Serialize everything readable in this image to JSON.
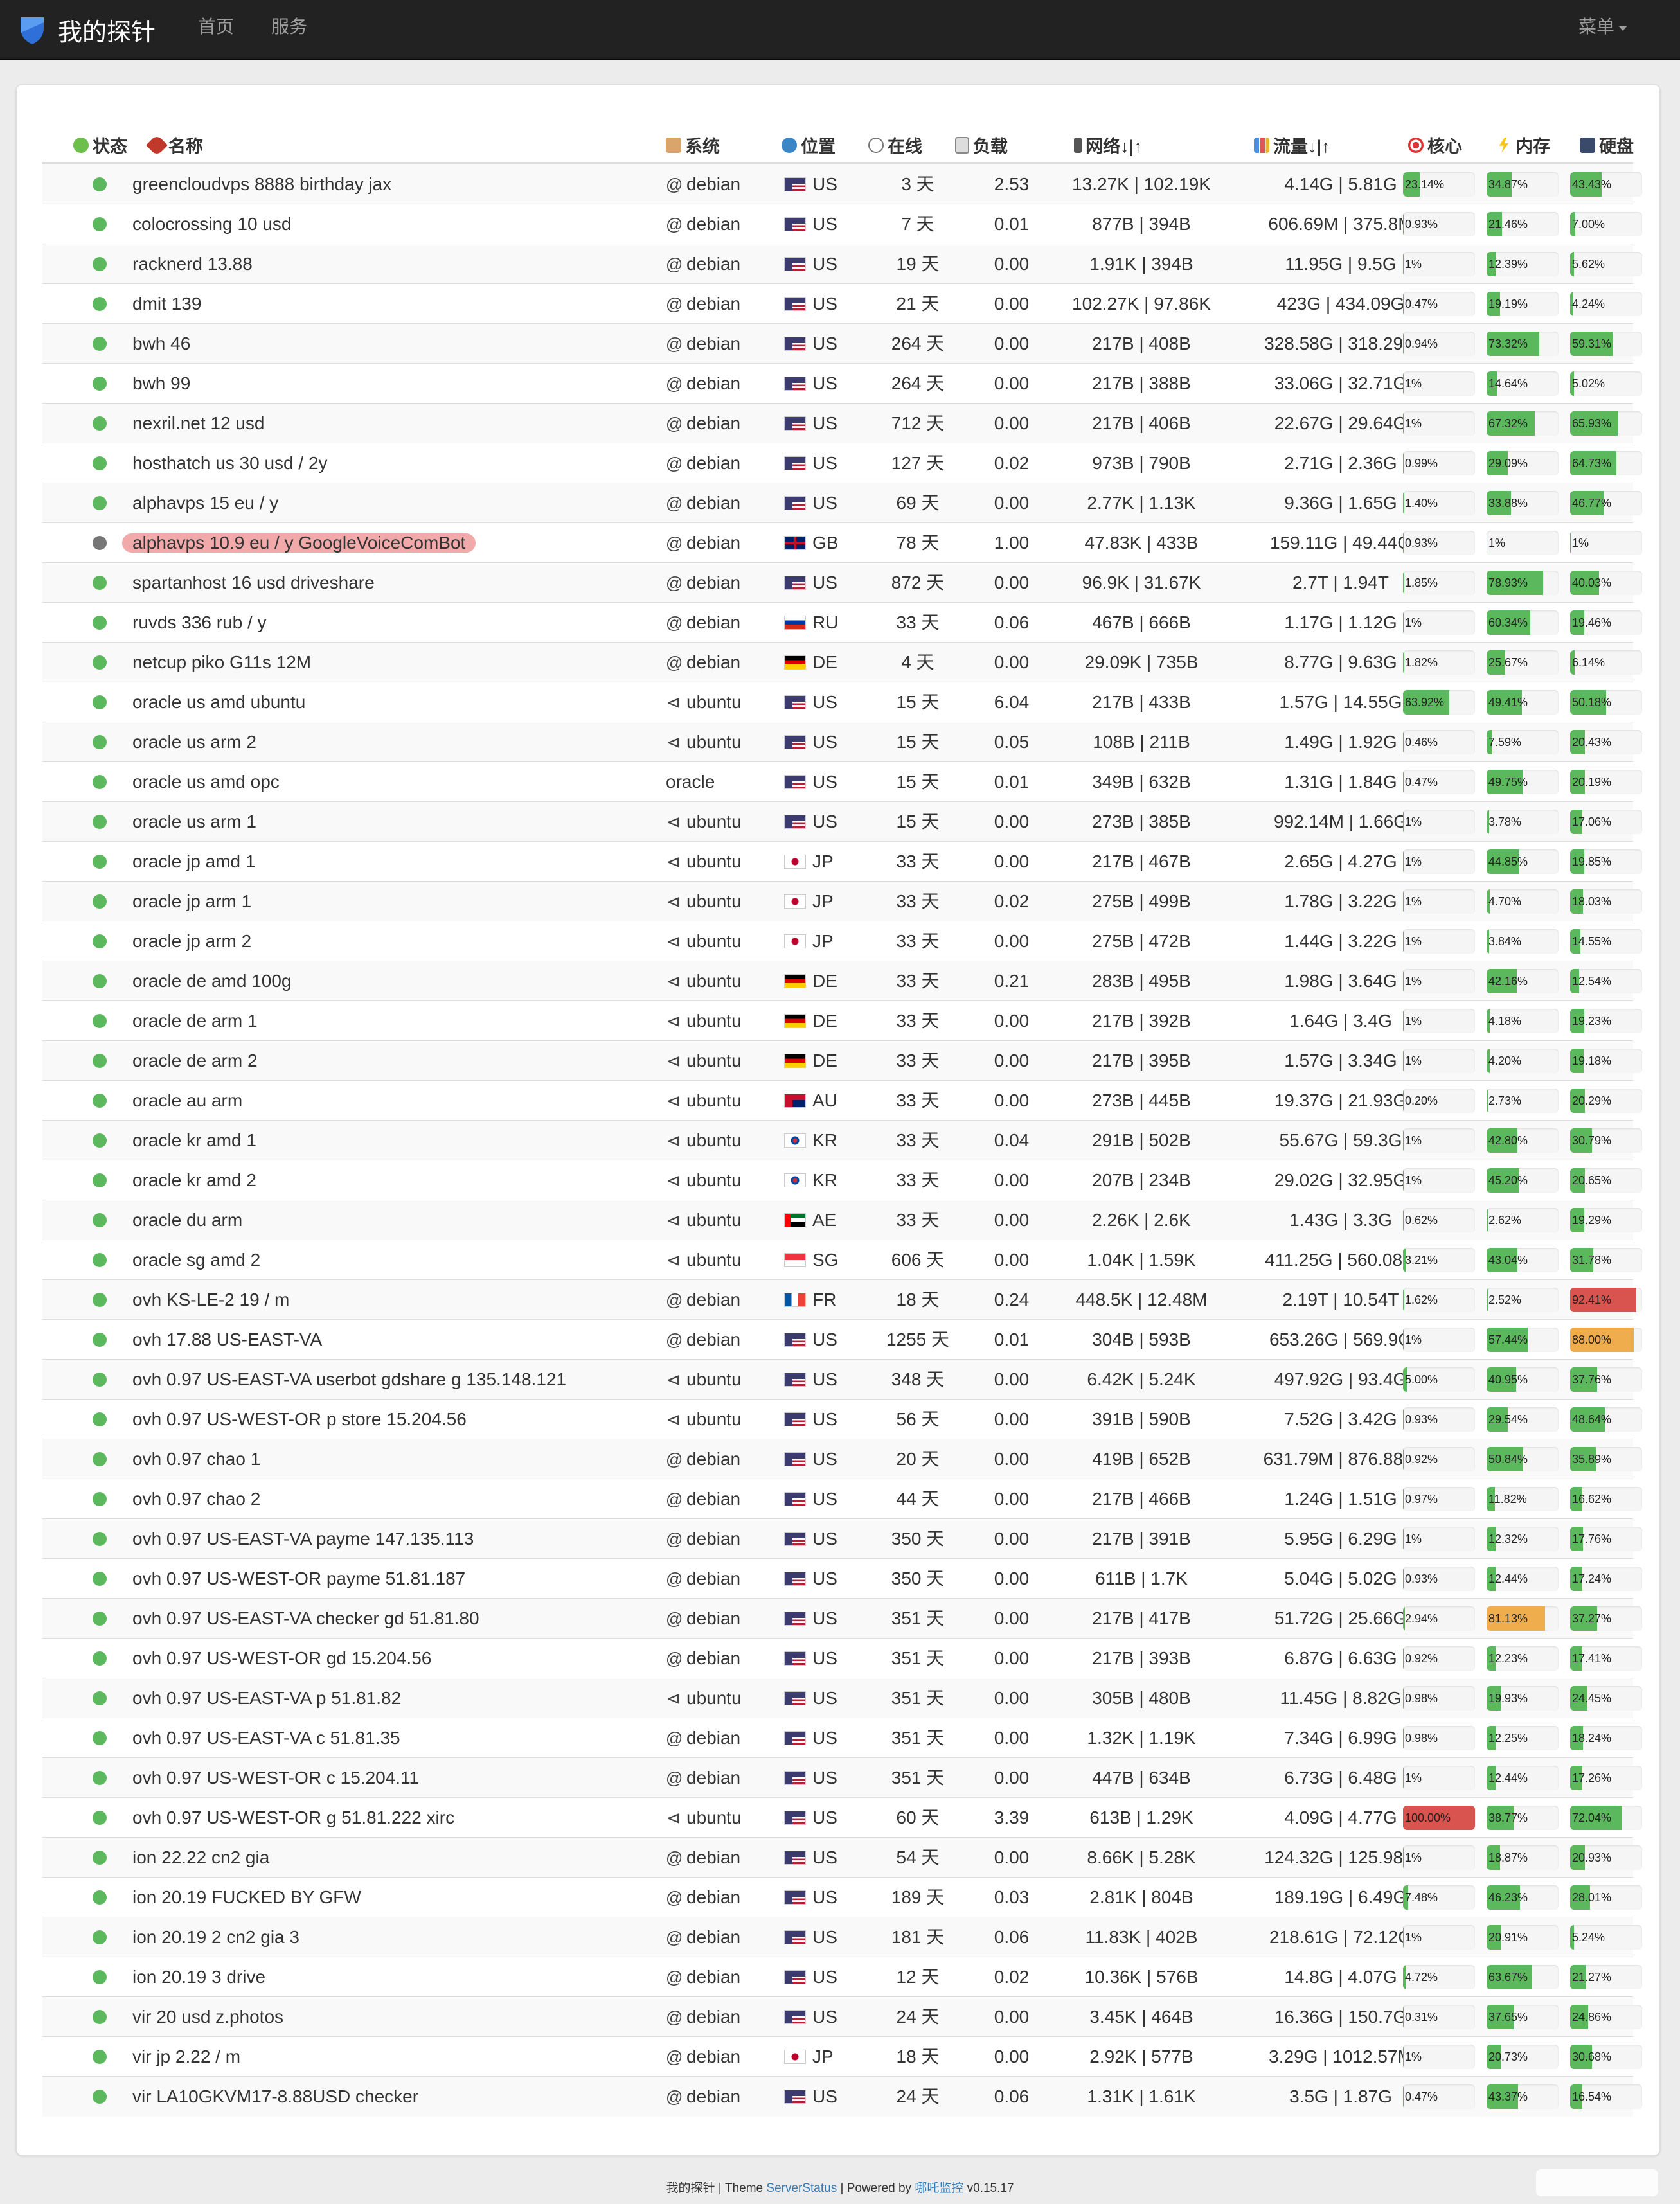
{
  "navbar": {
    "brand": "我的探针",
    "links": [
      "首页",
      "服务"
    ],
    "menu": "菜单"
  },
  "headers": {
    "status": "状态",
    "name": "名称",
    "os": "系统",
    "location": "位置",
    "uptime": "在线",
    "load": "负载",
    "network": "网络↓|↑",
    "traffic": "流量↓|↑",
    "cpu": "核心",
    "memory": "内存",
    "disk": "硬盘"
  },
  "header_icons": {
    "status": "clover-icon",
    "name": "rocket-icon",
    "os": "cabinet-icon",
    "location": "globe-icon",
    "uptime": "clock-icon",
    "load": "clipboard-icon",
    "network": "traffic-light-icon",
    "traffic": "bar-chart-icon",
    "cpu": "target-icon",
    "memory": "lightning-icon",
    "disk": "floppy-disk-icon"
  },
  "colors": {
    "online": "#5cb85c",
    "offline": "#777777",
    "bar_ok": "#5cb85c",
    "bar_warn": "#f0ad4e",
    "bar_danger": "#d9534f",
    "highlight": "#f2a9a9"
  },
  "servers": [
    {
      "online": true,
      "name": "greencloudvps 8888 birthday jax",
      "os": "debian",
      "loc": "US",
      "uptime": "3 天",
      "load": "2.53",
      "net": "13.27K | 102.19K",
      "traffic": "4.14G | 5.81G",
      "cpu": "23.14%",
      "mem": "34.87%",
      "disk": "43.43%"
    },
    {
      "online": true,
      "name": "colocrossing 10 usd",
      "os": "debian",
      "loc": "US",
      "uptime": "7 天",
      "load": "0.01",
      "net": "877B | 394B",
      "traffic": "606.69M | 375.8M",
      "cpu": "0.93%",
      "mem": "21.46%",
      "disk": "7.00%"
    },
    {
      "online": true,
      "name": "racknerd 13.88",
      "os": "debian",
      "loc": "US",
      "uptime": "19 天",
      "load": "0.00",
      "net": "1.91K | 394B",
      "traffic": "11.95G | 9.5G",
      "cpu": "1%",
      "mem": "12.39%",
      "disk": "5.62%"
    },
    {
      "online": true,
      "name": "dmit 139",
      "os": "debian",
      "loc": "US",
      "uptime": "21 天",
      "load": "0.00",
      "net": "102.27K | 97.86K",
      "traffic": "423G | 434.09G",
      "cpu": "0.47%",
      "mem": "19.19%",
      "disk": "4.24%"
    },
    {
      "online": true,
      "name": "bwh 46",
      "os": "debian",
      "loc": "US",
      "uptime": "264 天",
      "load": "0.00",
      "net": "217B | 408B",
      "traffic": "328.58G | 318.29G",
      "cpu": "0.94%",
      "mem": "73.32%",
      "disk": "59.31%"
    },
    {
      "online": true,
      "name": "bwh 99",
      "os": "debian",
      "loc": "US",
      "uptime": "264 天",
      "load": "0.00",
      "net": "217B | 388B",
      "traffic": "33.06G | 32.71G",
      "cpu": "1%",
      "mem": "14.64%",
      "disk": "5.02%"
    },
    {
      "online": true,
      "name": "nexril.net 12 usd",
      "os": "debian",
      "loc": "US",
      "uptime": "712 天",
      "load": "0.00",
      "net": "217B | 406B",
      "traffic": "22.67G | 29.64G",
      "cpu": "1%",
      "mem": "67.32%",
      "disk": "65.93%"
    },
    {
      "online": true,
      "name": "hosthatch us 30 usd / 2y",
      "os": "debian",
      "loc": "US",
      "uptime": "127 天",
      "load": "0.02",
      "net": "973B | 790B",
      "traffic": "2.71G | 2.36G",
      "cpu": "0.99%",
      "mem": "29.09%",
      "disk": "64.73%"
    },
    {
      "online": true,
      "name": "alphavps 15 eu / y",
      "os": "debian",
      "loc": "US",
      "uptime": "69 天",
      "load": "0.00",
      "net": "2.77K | 1.13K",
      "traffic": "9.36G | 1.65G",
      "cpu": "1.40%",
      "mem": "33.88%",
      "disk": "46.77%"
    },
    {
      "online": false,
      "name": "alphavps 10.9 eu / y GoogleVoiceComBot",
      "highlight": true,
      "os": "debian",
      "loc": "GB",
      "uptime": "78 天",
      "load": "1.00",
      "net": "47.83K | 433B",
      "traffic": "159.11G | 49.44G",
      "cpu": "0.93%",
      "mem": "1%",
      "disk": "1%"
    },
    {
      "online": true,
      "name": "spartanhost 16 usd driveshare",
      "os": "debian",
      "loc": "US",
      "uptime": "872 天",
      "load": "0.00",
      "net": "96.9K | 31.67K",
      "traffic": "2.7T | 1.94T",
      "cpu": "1.85%",
      "mem": "78.93%",
      "disk": "40.03%"
    },
    {
      "online": true,
      "name": "ruvds 336 rub / y",
      "os": "debian",
      "loc": "RU",
      "uptime": "33 天",
      "load": "0.06",
      "net": "467B | 666B",
      "traffic": "1.17G | 1.12G",
      "cpu": "1%",
      "mem": "60.34%",
      "disk": "19.46%"
    },
    {
      "online": true,
      "name": "netcup piko G11s 12M",
      "os": "debian",
      "loc": "DE",
      "uptime": "4 天",
      "load": "0.00",
      "net": "29.09K | 735B",
      "traffic": "8.77G | 9.63G",
      "cpu": "1.82%",
      "mem": "25.67%",
      "disk": "6.14%"
    },
    {
      "online": true,
      "name": "oracle us amd ubuntu",
      "os": "ubuntu",
      "loc": "US",
      "uptime": "15 天",
      "load": "6.04",
      "net": "217B | 433B",
      "traffic": "1.57G | 14.55G",
      "cpu": "63.92%",
      "mem": "49.41%",
      "disk": "50.18%"
    },
    {
      "online": true,
      "name": "oracle us arm 2",
      "os": "ubuntu",
      "loc": "US",
      "uptime": "15 天",
      "load": "0.05",
      "net": "108B | 211B",
      "traffic": "1.49G | 1.92G",
      "cpu": "0.46%",
      "mem": "7.59%",
      "disk": "20.43%"
    },
    {
      "online": true,
      "name": "oracle us amd opc",
      "os": "oracle",
      "loc": "US",
      "uptime": "15 天",
      "load": "0.01",
      "net": "349B | 632B",
      "traffic": "1.31G | 1.84G",
      "cpu": "0.47%",
      "mem": "49.75%",
      "disk": "20.19%"
    },
    {
      "online": true,
      "name": "oracle us arm 1",
      "os": "ubuntu",
      "loc": "US",
      "uptime": "15 天",
      "load": "0.00",
      "net": "273B | 385B",
      "traffic": "992.14M | 1.66G",
      "cpu": "1%",
      "mem": "3.78%",
      "disk": "17.06%"
    },
    {
      "online": true,
      "name": "oracle jp amd 1",
      "os": "ubuntu",
      "loc": "JP",
      "uptime": "33 天",
      "load": "0.00",
      "net": "217B | 467B",
      "traffic": "2.65G | 4.27G",
      "cpu": "1%",
      "mem": "44.85%",
      "disk": "19.85%"
    },
    {
      "online": true,
      "name": "oracle jp arm 1",
      "os": "ubuntu",
      "loc": "JP",
      "uptime": "33 天",
      "load": "0.02",
      "net": "275B | 499B",
      "traffic": "1.78G | 3.22G",
      "cpu": "1%",
      "mem": "4.70%",
      "disk": "18.03%"
    },
    {
      "online": true,
      "name": "oracle jp arm 2",
      "os": "ubuntu",
      "loc": "JP",
      "uptime": "33 天",
      "load": "0.00",
      "net": "275B | 472B",
      "traffic": "1.44G | 3.22G",
      "cpu": "1%",
      "mem": "3.84%",
      "disk": "14.55%"
    },
    {
      "online": true,
      "name": "oracle de amd 100g",
      "os": "ubuntu",
      "loc": "DE",
      "uptime": "33 天",
      "load": "0.21",
      "net": "283B | 495B",
      "traffic": "1.98G | 3.64G",
      "cpu": "1%",
      "mem": "42.16%",
      "disk": "12.54%"
    },
    {
      "online": true,
      "name": "oracle de arm 1",
      "os": "ubuntu",
      "loc": "DE",
      "uptime": "33 天",
      "load": "0.00",
      "net": "217B | 392B",
      "traffic": "1.64G | 3.4G",
      "cpu": "1%",
      "mem": "4.18%",
      "disk": "19.23%"
    },
    {
      "online": true,
      "name": "oracle de arm 2",
      "os": "ubuntu",
      "loc": "DE",
      "uptime": "33 天",
      "load": "0.00",
      "net": "217B | 395B",
      "traffic": "1.57G | 3.34G",
      "cpu": "1%",
      "mem": "4.20%",
      "disk": "19.18%"
    },
    {
      "online": true,
      "name": "oracle au arm",
      "os": "ubuntu",
      "loc": "AU",
      "uptime": "33 天",
      "load": "0.00",
      "net": "273B | 445B",
      "traffic": "19.37G | 21.93G",
      "cpu": "0.20%",
      "mem": "2.73%",
      "disk": "20.29%"
    },
    {
      "online": true,
      "name": "oracle kr amd 1",
      "os": "ubuntu",
      "loc": "KR",
      "uptime": "33 天",
      "load": "0.04",
      "net": "291B | 502B",
      "traffic": "55.67G | 59.3G",
      "cpu": "1%",
      "mem": "42.80%",
      "disk": "30.79%"
    },
    {
      "online": true,
      "name": "oracle kr amd 2",
      "os": "ubuntu",
      "loc": "KR",
      "uptime": "33 天",
      "load": "0.00",
      "net": "207B | 234B",
      "traffic": "29.02G | 32.95G",
      "cpu": "1%",
      "mem": "45.20%",
      "disk": "20.65%"
    },
    {
      "online": true,
      "name": "oracle du arm",
      "os": "ubuntu",
      "loc": "AE",
      "uptime": "33 天",
      "load": "0.00",
      "net": "2.26K | 2.6K",
      "traffic": "1.43G | 3.3G",
      "cpu": "0.62%",
      "mem": "2.62%",
      "disk": "19.29%"
    },
    {
      "online": true,
      "name": "oracle sg amd 2",
      "os": "ubuntu",
      "loc": "SG",
      "uptime": "606 天",
      "load": "0.00",
      "net": "1.04K | 1.59K",
      "traffic": "411.25G | 560.08G",
      "cpu": "3.21%",
      "mem": "43.04%",
      "disk": "31.78%"
    },
    {
      "online": true,
      "name": "ovh KS-LE-2 19 / m",
      "os": "debian",
      "loc": "FR",
      "uptime": "18 天",
      "load": "0.24",
      "net": "448.5K | 12.48M",
      "traffic": "2.19T | 10.54T",
      "cpu": "1.62%",
      "mem": "2.52%",
      "disk": "92.41%"
    },
    {
      "online": true,
      "name": "ovh 17.88 US-EAST-VA",
      "os": "debian",
      "loc": "US",
      "uptime": "1255 天",
      "load": "0.01",
      "net": "304B | 593B",
      "traffic": "653.26G | 569.9G",
      "cpu": "1%",
      "mem": "57.44%",
      "disk": "88.00%"
    },
    {
      "online": true,
      "name": "ovh 0.97 US-EAST-VA userbot gdshare g 135.148.121",
      "os": "ubuntu",
      "loc": "US",
      "uptime": "348 天",
      "load": "0.00",
      "net": "6.42K | 5.24K",
      "traffic": "497.92G | 93.4G",
      "cpu": "5.00%",
      "mem": "40.95%",
      "disk": "37.76%"
    },
    {
      "online": true,
      "name": "ovh 0.97 US-WEST-OR p store 15.204.56",
      "os": "ubuntu",
      "loc": "US",
      "uptime": "56 天",
      "load": "0.00",
      "net": "391B | 590B",
      "traffic": "7.52G | 3.42G",
      "cpu": "0.93%",
      "mem": "29.54%",
      "disk": "48.64%"
    },
    {
      "online": true,
      "name": "ovh 0.97 chao 1",
      "os": "debian",
      "loc": "US",
      "uptime": "20 天",
      "load": "0.00",
      "net": "419B | 652B",
      "traffic": "631.79M | 876.88M",
      "cpu": "0.92%",
      "mem": "50.84%",
      "disk": "35.89%"
    },
    {
      "online": true,
      "name": "ovh 0.97 chao 2",
      "os": "debian",
      "loc": "US",
      "uptime": "44 天",
      "load": "0.00",
      "net": "217B | 466B",
      "traffic": "1.24G | 1.51G",
      "cpu": "0.97%",
      "mem": "11.82%",
      "disk": "16.62%"
    },
    {
      "online": true,
      "name": "ovh 0.97 US-EAST-VA payme 147.135.113",
      "os": "debian",
      "loc": "US",
      "uptime": "350 天",
      "load": "0.00",
      "net": "217B | 391B",
      "traffic": "5.95G | 6.29G",
      "cpu": "1%",
      "mem": "12.32%",
      "disk": "17.76%"
    },
    {
      "online": true,
      "name": "ovh 0.97 US-WEST-OR payme 51.81.187",
      "os": "debian",
      "loc": "US",
      "uptime": "350 天",
      "load": "0.00",
      "net": "611B | 1.7K",
      "traffic": "5.04G | 5.02G",
      "cpu": "0.93%",
      "mem": "12.44%",
      "disk": "17.24%"
    },
    {
      "online": true,
      "name": "ovh 0.97 US-EAST-VA checker gd 51.81.80",
      "os": "debian",
      "loc": "US",
      "uptime": "351 天",
      "load": "0.00",
      "net": "217B | 417B",
      "traffic": "51.72G | 25.66G",
      "cpu": "2.94%",
      "mem": "81.13%",
      "disk": "37.27%"
    },
    {
      "online": true,
      "name": "ovh 0.97 US-WEST-OR gd 15.204.56",
      "os": "debian",
      "loc": "US",
      "uptime": "351 天",
      "load": "0.00",
      "net": "217B | 393B",
      "traffic": "6.87G | 6.63G",
      "cpu": "0.92%",
      "mem": "12.23%",
      "disk": "17.41%"
    },
    {
      "online": true,
      "name": "ovh 0.97 US-EAST-VA p 51.81.82",
      "os": "ubuntu",
      "loc": "US",
      "uptime": "351 天",
      "load": "0.00",
      "net": "305B | 480B",
      "traffic": "11.45G | 8.82G",
      "cpu": "0.98%",
      "mem": "19.93%",
      "disk": "24.45%"
    },
    {
      "online": true,
      "name": "ovh 0.97 US-EAST-VA c 51.81.35",
      "os": "debian",
      "loc": "US",
      "uptime": "351 天",
      "load": "0.00",
      "net": "1.32K | 1.19K",
      "traffic": "7.34G | 6.99G",
      "cpu": "0.98%",
      "mem": "12.25%",
      "disk": "18.24%"
    },
    {
      "online": true,
      "name": "ovh 0.97 US-WEST-OR c 15.204.11",
      "os": "debian",
      "loc": "US",
      "uptime": "351 天",
      "load": "0.00",
      "net": "447B | 634B",
      "traffic": "6.73G | 6.48G",
      "cpu": "1%",
      "mem": "12.44%",
      "disk": "17.26%"
    },
    {
      "online": true,
      "name": "ovh 0.97 US-WEST-OR g 51.81.222 xirc",
      "os": "ubuntu",
      "loc": "US",
      "uptime": "60 天",
      "load": "3.39",
      "net": "613B | 1.29K",
      "traffic": "4.09G | 4.77G",
      "cpu": "100.00%",
      "mem": "38.77%",
      "disk": "72.04%"
    },
    {
      "online": true,
      "name": "ion 22.22 cn2 gia",
      "os": "debian",
      "loc": "US",
      "uptime": "54 天",
      "load": "0.00",
      "net": "8.66K | 5.28K",
      "traffic": "124.32G | 125.98G",
      "cpu": "1%",
      "mem": "18.87%",
      "disk": "20.93%"
    },
    {
      "online": true,
      "name": "ion 20.19 FUCKED BY GFW",
      "os": "debian",
      "loc": "US",
      "uptime": "189 天",
      "load": "0.03",
      "net": "2.81K | 804B",
      "traffic": "189.19G | 6.49G",
      "cpu": "7.48%",
      "mem": "46.23%",
      "disk": "28.01%"
    },
    {
      "online": true,
      "name": "ion 20.19 2 cn2 gia 3",
      "os": "debian",
      "loc": "US",
      "uptime": "181 天",
      "load": "0.06",
      "net": "11.83K | 402B",
      "traffic": "218.61G | 72.12G",
      "cpu": "1%",
      "mem": "20.91%",
      "disk": "5.24%"
    },
    {
      "online": true,
      "name": "ion 20.19 3 drive",
      "os": "debian",
      "loc": "US",
      "uptime": "12 天",
      "load": "0.02",
      "net": "10.36K | 576B",
      "traffic": "14.8G | 4.07G",
      "cpu": "4.72%",
      "mem": "63.67%",
      "disk": "21.27%"
    },
    {
      "online": true,
      "name": "vir 20 usd z.photos",
      "os": "debian",
      "loc": "US",
      "uptime": "24 天",
      "load": "0.00",
      "net": "3.45K | 464B",
      "traffic": "16.36G | 150.7G",
      "cpu": "0.31%",
      "mem": "37.65%",
      "disk": "24.86%"
    },
    {
      "online": true,
      "name": "vir jp 2.22 / m",
      "os": "debian",
      "loc": "JP",
      "uptime": "18 天",
      "load": "0.00",
      "net": "2.92K | 577B",
      "traffic": "3.29G | 1012.57M",
      "cpu": "1%",
      "mem": "20.73%",
      "disk": "30.68%"
    },
    {
      "online": true,
      "name": "vir LA10GKVM17-8.88USD checker",
      "os": "debian",
      "loc": "US",
      "uptime": "24 天",
      "load": "0.06",
      "net": "1.31K | 1.61K",
      "traffic": "3.5G | 1.87G",
      "cpu": "0.47%",
      "mem": "43.37%",
      "disk": "16.54%"
    }
  ],
  "footer": {
    "prefix": "我的探针 | Theme ",
    "theme": "ServerStatus",
    "mid": " | Powered by ",
    "powered": "哪吒监控",
    "version": " v0.15.17"
  }
}
